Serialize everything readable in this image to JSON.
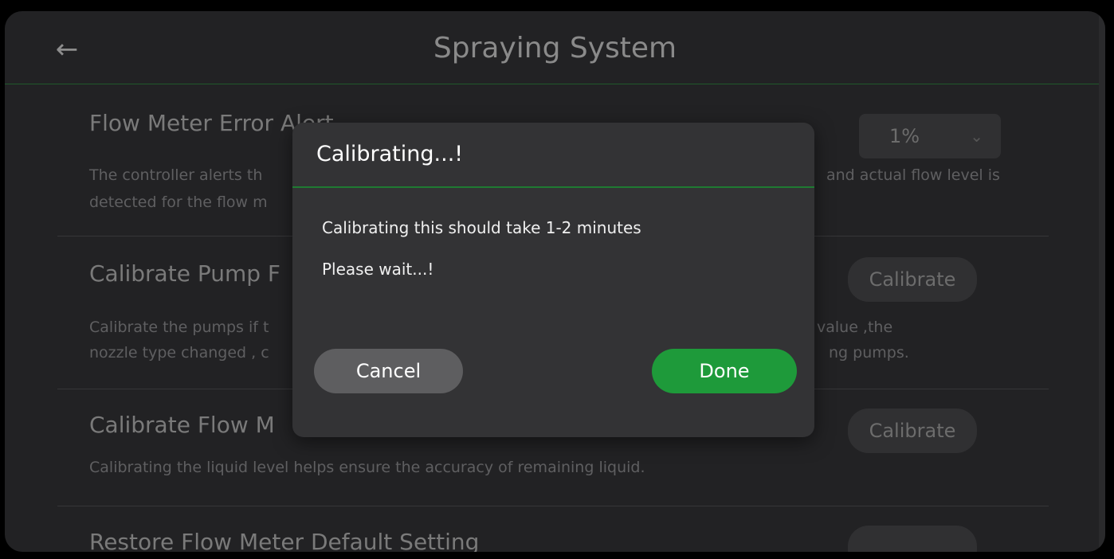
{
  "header": {
    "title": "Spraying System",
    "back_icon": "arrow-left-icon"
  },
  "settings": [
    {
      "title": "Flow Meter Error Alert",
      "description": "The controller alerts th… and actual flow level is detected for the flow m…",
      "desc_line1": "The controller alerts th",
      "desc_line1_right": "and actual flow level is",
      "desc_line2": "detected for the flow m",
      "control": {
        "type": "select",
        "value": "1%"
      }
    },
    {
      "title": "Calibrate Pump F",
      "desc_line1": "Calibrate the pumps if t",
      "desc_line1_right": "value ,the",
      "desc_line2": "nozzle type changed , c",
      "desc_line2_right": "ng pumps.",
      "control": {
        "type": "button",
        "label": "Calibrate"
      }
    },
    {
      "title": "Calibrate Flow M",
      "desc_line1": "Calibrating the liquid level helps ensure the accuracy of remaining liquid.",
      "control": {
        "type": "button",
        "label": "Calibrate"
      }
    },
    {
      "title": "Restore Flow Meter Default Setting",
      "control": {
        "type": "button",
        "label": ""
      }
    }
  ],
  "dialog": {
    "title": "Calibrating...!",
    "message_line1": "Calibrating this should take 1-2 minutes",
    "message_line2": "Please wait...!",
    "cancel_label": "Cancel",
    "done_label": "Done"
  },
  "colors": {
    "accent": "#1e9a3a",
    "background": "#222224",
    "dialog": "#333335"
  }
}
